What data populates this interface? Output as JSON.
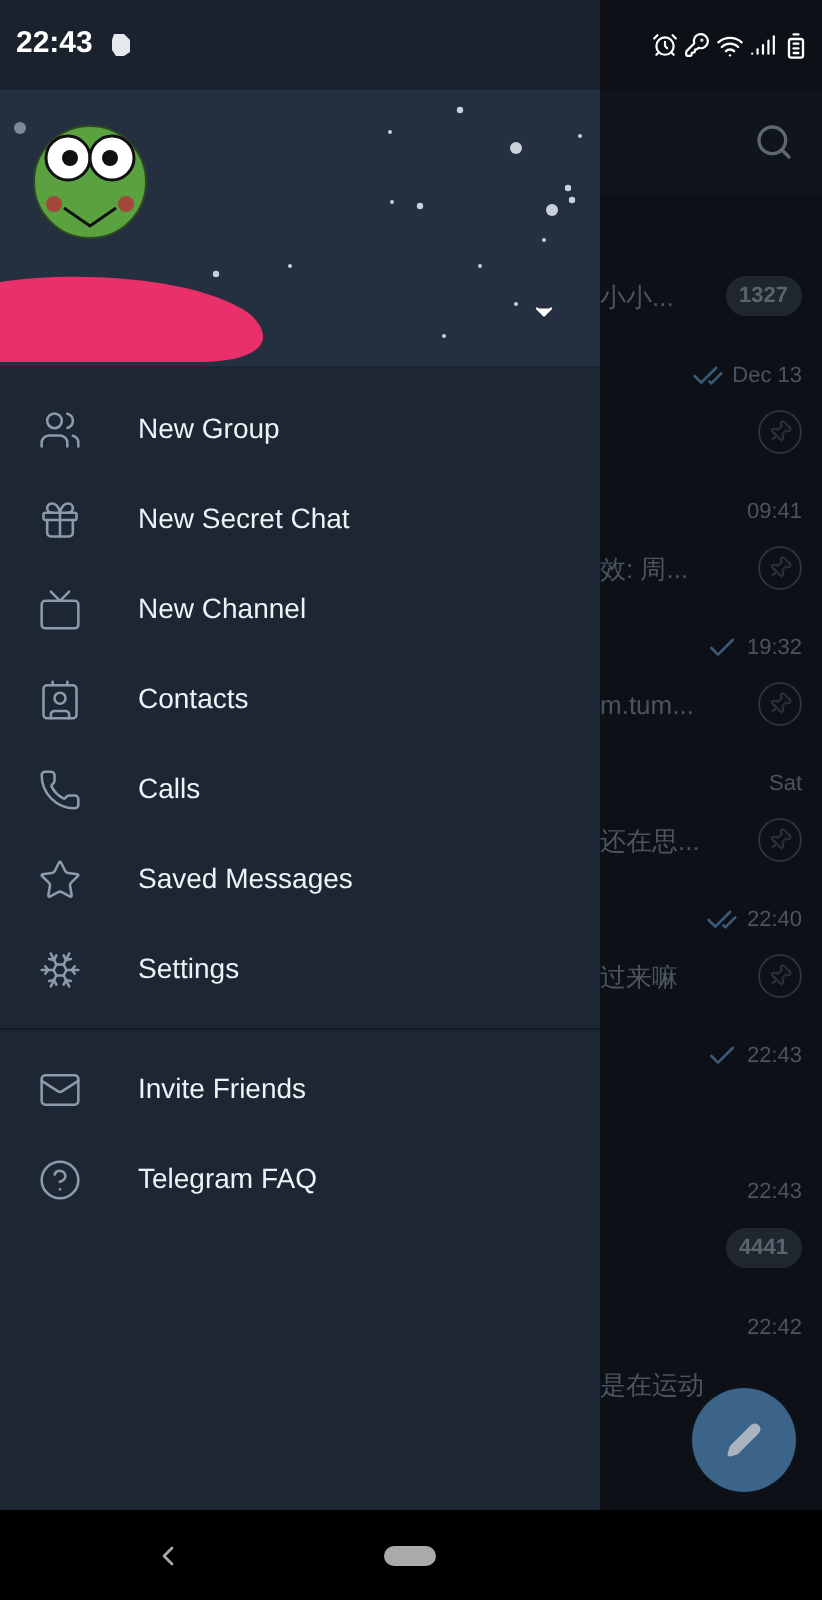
{
  "status_bar": {
    "time": "22:43"
  },
  "drawer": {
    "menu": [
      {
        "label": "New Group"
      },
      {
        "label": "New Secret Chat"
      },
      {
        "label": "New Channel"
      },
      {
        "label": "Contacts"
      },
      {
        "label": "Calls"
      },
      {
        "label": "Saved Messages"
      },
      {
        "label": "Settings"
      }
    ],
    "extra_menu": [
      {
        "label": "Invite Friends"
      },
      {
        "label": "Telegram FAQ"
      }
    ]
  },
  "chats": [
    {
      "preview": "小小...",
      "badge": "1327",
      "pinned": false,
      "sent": false,
      "read": false
    },
    {
      "time": "Dec 13",
      "sent": true,
      "read": true,
      "pinned": true
    },
    {
      "time": "09:41",
      "preview": "效: 周...",
      "pinned": true,
      "sent": false,
      "read": false
    },
    {
      "time": "19:32",
      "sent": true,
      "read": false,
      "preview": "m.tum...",
      "pinned": true
    },
    {
      "time": "Sat",
      "preview": "还在思...",
      "pinned": true,
      "sent": false,
      "read": false
    },
    {
      "time": "22:40",
      "sent": true,
      "read": true,
      "preview": "过来嘛",
      "pinned": true
    },
    {
      "time": "22:43",
      "sent": true,
      "read": false,
      "pinned": false
    },
    {
      "time": "22:43",
      "badge": "4441",
      "pinned": false,
      "sent": false,
      "read": false
    },
    {
      "time": "22:42",
      "preview": "是在运动",
      "pinned": false,
      "sent": false,
      "read": false
    }
  ]
}
